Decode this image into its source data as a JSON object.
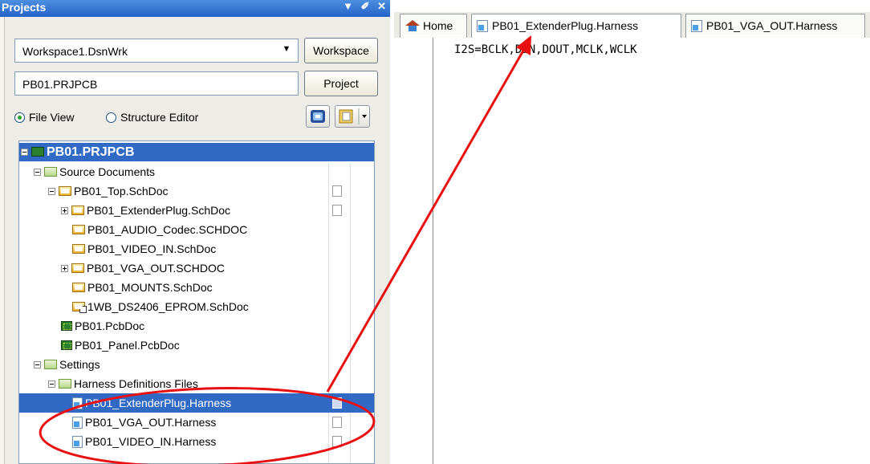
{
  "panel": {
    "title": "Projects",
    "title_controls": "▼ ✐ ✕",
    "workspace_combo_value": "Workspace1.DsnWrk",
    "workspace_button": "Workspace",
    "project_field_value": "PB01.PRJPCB",
    "project_button": "Project",
    "view_options": [
      {
        "label": "File View",
        "selected": true
      },
      {
        "label": "Structure Editor",
        "selected": false
      }
    ]
  },
  "tree": {
    "root": "PB01.PRJPCB",
    "rows": [
      {
        "label": "Source Documents",
        "icon": "folder-icon"
      },
      {
        "label": "PB01_Top.SchDoc",
        "icon": "schematic-icon"
      },
      {
        "label": "PB01_ExtenderPlug.SchDoc",
        "icon": "schematic-icon"
      },
      {
        "label": "PB01_AUDIO_Codec.SCHDOC",
        "icon": "schematic-icon"
      },
      {
        "label": "PB01_VIDEO_IN.SchDoc",
        "icon": "schematic-icon"
      },
      {
        "label": "PB01_VGA_OUT.SCHDOC",
        "icon": "schematic-icon"
      },
      {
        "label": "PB01_MOUNTS.SchDoc",
        "icon": "schematic-icon"
      },
      {
        "label": "1WB_DS2406_EPROM.SchDoc",
        "icon": "schematic-link-icon"
      },
      {
        "label": "PB01.PcbDoc",
        "icon": "pcb-icon"
      },
      {
        "label": "PB01_Panel.PcbDoc",
        "icon": "pcb-icon"
      },
      {
        "label": "Settings",
        "icon": "folder-icon"
      },
      {
        "label": "Harness Definitions Files",
        "icon": "folder-icon"
      },
      {
        "label": "PB01_ExtenderPlug.Harness",
        "icon": "harness-icon",
        "selected": true
      },
      {
        "label": "PB01_VGA_OUT.Harness",
        "icon": "harness-icon"
      },
      {
        "label": "PB01_VIDEO_IN.Harness",
        "icon": "harness-icon"
      }
    ]
  },
  "tabs": [
    {
      "label": "Home",
      "icon": "home-icon"
    },
    {
      "label": "PB01_ExtenderPlug.Harness",
      "icon": "harness-icon",
      "active": true
    },
    {
      "label": "PB01_VGA_OUT.Harness",
      "icon": "harness-icon"
    }
  ],
  "editor": {
    "line1": "I2S=BCLK,DIN,DOUT,MCLK,WCLK"
  },
  "annotation_color": "#e81010"
}
